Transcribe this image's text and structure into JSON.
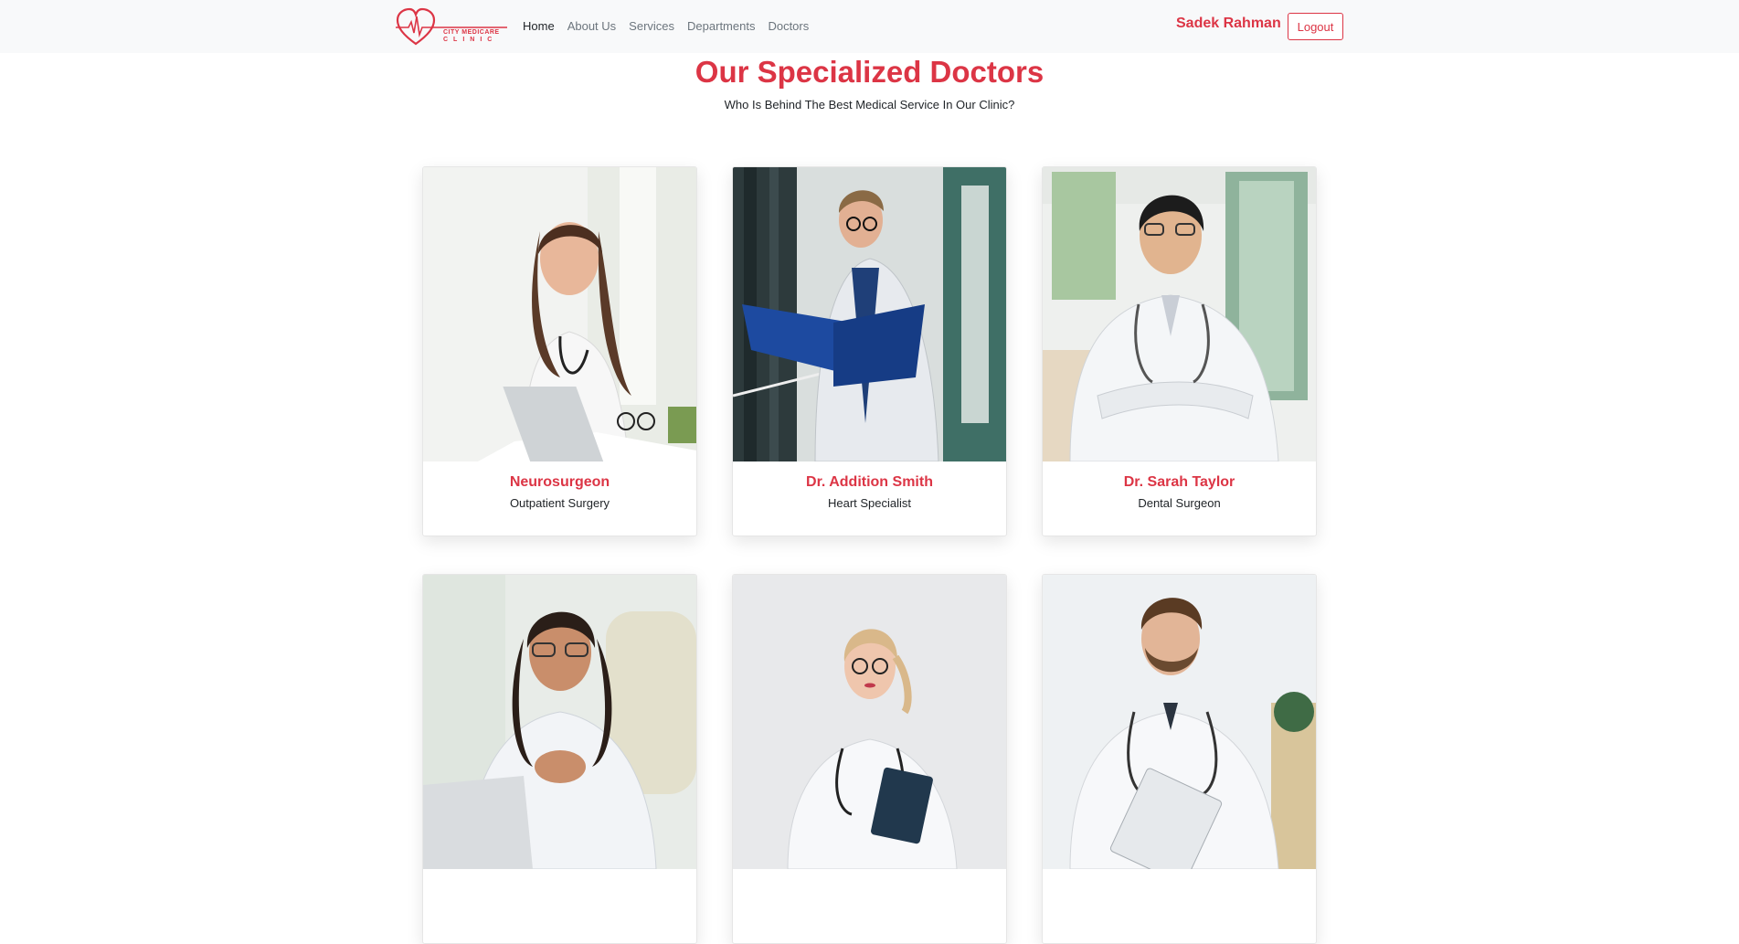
{
  "brand": {
    "line1": "CITY MEDICARE",
    "line2": "CLINIC",
    "accent": "#dc3545"
  },
  "nav": {
    "items": [
      "Home",
      "About Us",
      "Services",
      "Departments",
      "Doctors"
    ],
    "active": "Home"
  },
  "user": {
    "name": "Sadek Rahman",
    "logout_label": "Logout"
  },
  "section": {
    "title": "Our Specialized Doctors",
    "subtitle": "Who Is Behind The Best Medical Service In Our Clinic?"
  },
  "doctors": [
    {
      "name": "Neurosurgeon",
      "role": "Outpatient Surgery",
      "photo": "doctor-photo-woman-brunette"
    },
    {
      "name": "Dr. Addition Smith",
      "role": "Heart Specialist",
      "photo": "doctor-photo-man-folder"
    },
    {
      "name": "Dr. Sarah Taylor",
      "role": "Dental Surgeon",
      "photo": "doctor-photo-man-arms-crossed"
    },
    {
      "name": "",
      "role": "",
      "photo": "doctor-photo-woman-glasses"
    },
    {
      "name": "",
      "role": "",
      "photo": "doctor-photo-woman-blonde"
    },
    {
      "name": "",
      "role": "",
      "photo": "doctor-photo-man-clipboard"
    }
  ]
}
